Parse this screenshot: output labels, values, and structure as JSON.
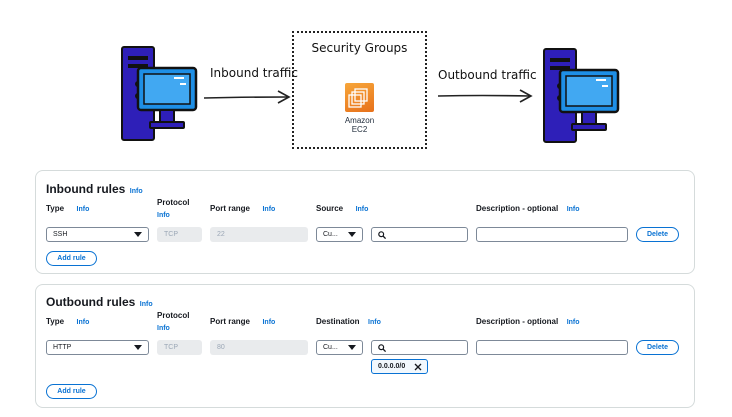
{
  "diagram": {
    "inbound_label": "Inbound traffic",
    "outbound_label": "Outbound traffic",
    "security_groups_label": "Security Groups",
    "ec2_line1": "Amazon",
    "ec2_line2": "EC2"
  },
  "inbound": {
    "title": "Inbound rules",
    "title_info": "Info",
    "headers": {
      "type": "Type",
      "type_info": "Info",
      "protocol": "Protocol",
      "protocol_info": "Info",
      "port_range": "Port range",
      "port_range_info": "Info",
      "source": "Source",
      "source_info": "Info",
      "description": "Description - optional",
      "description_info": "Info"
    },
    "row": {
      "type": "SSH",
      "protocol": "TCP",
      "port": "22",
      "source": "Cu...",
      "delete_label": "Delete"
    },
    "add_rule_label": "Add rule"
  },
  "outbound": {
    "title": "Outbound rules",
    "title_info": "Info",
    "headers": {
      "type": "Type",
      "type_info": "Info",
      "protocol": "Protocol",
      "protocol_info": "Info",
      "port_range": "Port range",
      "port_range_info": "Info",
      "destination": "Destination",
      "destination_info": "Info",
      "description": "Description - optional",
      "description_info": "Info"
    },
    "row": {
      "type": "HTTP",
      "protocol": "TCP",
      "port": "80",
      "destination": "Cu...",
      "token": "0.0.0.0/0",
      "delete_label": "Delete"
    },
    "add_rule_label": "Add rule"
  },
  "colors": {
    "accent": "#0972d3",
    "server_blue": "#2e1fb8",
    "monitor_blue": "#1e8fe6",
    "ec2_orange": "#e7711b"
  }
}
